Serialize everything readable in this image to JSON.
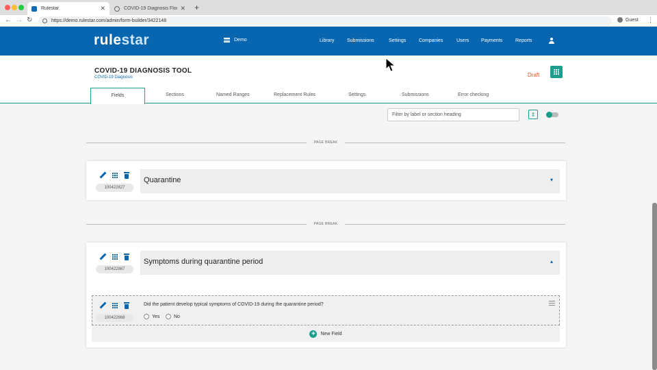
{
  "browser": {
    "tabs": [
      {
        "title": "Rulestar",
        "active": true
      },
      {
        "title": "COVID-19 Diagnosis Flowchar",
        "active": false
      }
    ],
    "url": "https://demo.rulestar.com/admin/form-builder/3422148",
    "profile": "Guest",
    "icons": {
      "back": "back-arrow-icon",
      "forward": "forward-arrow-icon",
      "reload": "reload-icon",
      "close": "close-icon",
      "new_tab": "plus-icon",
      "menu": "kebab-menu-icon"
    }
  },
  "header": {
    "logo": {
      "part1": "rule",
      "part2": "star"
    },
    "workspace": "Demo",
    "nav": [
      "Library",
      "Submissions",
      "Settings",
      "Companies",
      "Users",
      "Payments",
      "Reports"
    ],
    "bg_color": "#0866b0"
  },
  "tool": {
    "title": "COVID-19 DIAGNOSIS TOOL",
    "subtitle": "COVID-19 Diagnosis",
    "status": "Draft",
    "status_color": "#d9531e",
    "accent_color": "#1b9e8d",
    "tabs": [
      "Fields",
      "Sections",
      "Named Ranges",
      "Replacement Rules",
      "Settings",
      "Submissions",
      "Error checking"
    ],
    "active_tab": "Fields"
  },
  "filter": {
    "placeholder": "Filter by label or section heading"
  },
  "page_break_label": "PAGE BREAK",
  "sections": [
    {
      "id": "100422827",
      "heading": "Quarantine",
      "expanded": false
    },
    {
      "id": "100422867",
      "heading": "Symptoms during quarantine period",
      "expanded": true,
      "fields": [
        {
          "id": "100422868",
          "question": "Did the patient develop typical symptoms of COVID-19 during the quarantine period?",
          "options": [
            "Yes",
            "No"
          ]
        }
      ],
      "new_field_label": "New Field"
    }
  ]
}
